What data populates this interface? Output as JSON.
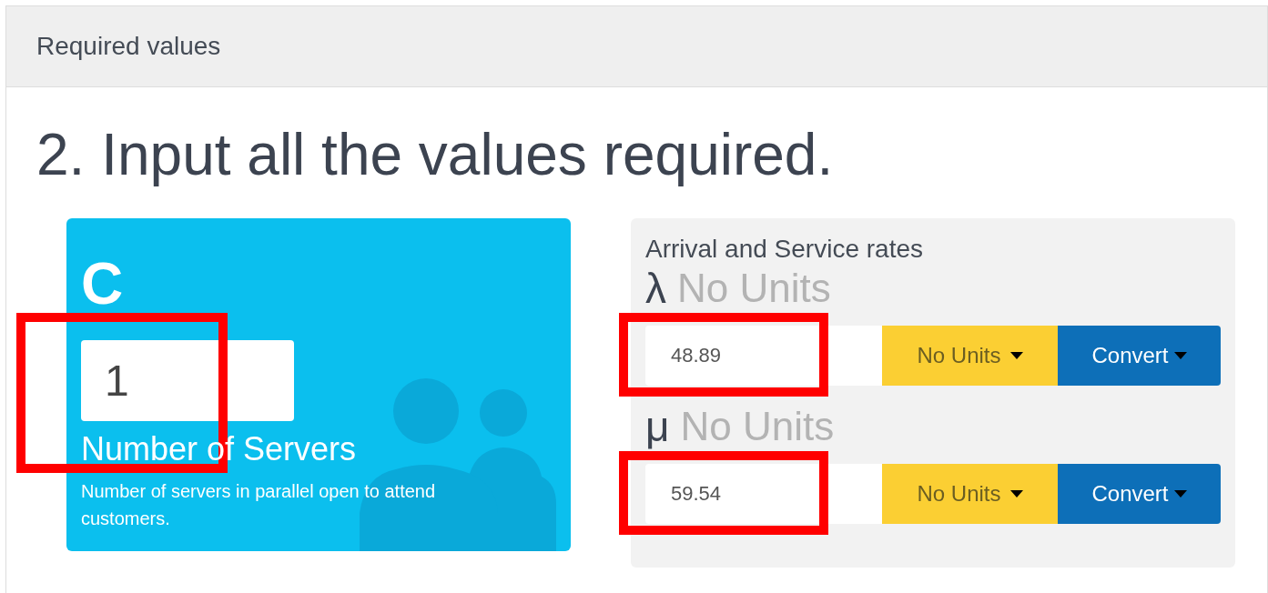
{
  "header": {
    "title": "Required values"
  },
  "heading": "2. Input all the values required.",
  "server_card": {
    "symbol": "C",
    "value": "1",
    "highlighted": true,
    "label": "Number of Servers",
    "description": "Number of servers in parallel open to attend customers."
  },
  "rates_panel": {
    "title": "Arrival and Service rates",
    "rates": [
      {
        "symbol": "λ",
        "unit_label": "No Units",
        "value": "48.89",
        "highlighted": true,
        "unit_button": "No Units",
        "convert_button": "Convert"
      },
      {
        "symbol": "μ",
        "unit_label": "No Units",
        "value": "59.54",
        "highlighted": true,
        "unit_button": "No Units",
        "convert_button": "Convert"
      }
    ]
  }
}
